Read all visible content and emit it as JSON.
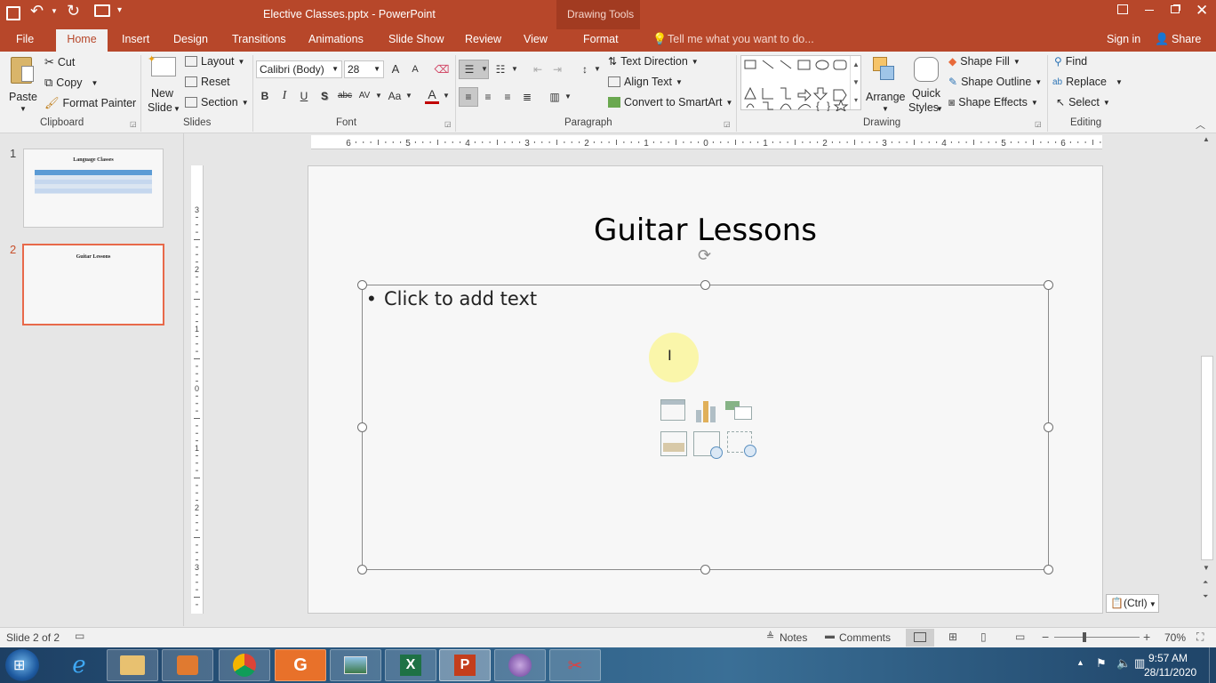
{
  "titlebar": {
    "document_title": "Elective Classes.pptx - PowerPoint",
    "context_title": "Drawing Tools"
  },
  "tabs": [
    {
      "label": "File"
    },
    {
      "label": "Home"
    },
    {
      "label": "Insert"
    },
    {
      "label": "Design"
    },
    {
      "label": "Transitions"
    },
    {
      "label": "Animations"
    },
    {
      "label": "Slide Show"
    },
    {
      "label": "Review"
    },
    {
      "label": "View"
    },
    {
      "label": "Format"
    }
  ],
  "tell_me": {
    "placeholder": "Tell me what you want to do..."
  },
  "account": {
    "sign_in": "Sign in",
    "share": "Share"
  },
  "ribbon": {
    "clipboard": {
      "label": "Clipboard",
      "paste": "Paste",
      "cut": "Cut",
      "copy": "Copy",
      "format_painter": "Format Painter"
    },
    "slides": {
      "label": "Slides",
      "new_slide_line1": "New",
      "new_slide_line2": "Slide",
      "layout": "Layout",
      "reset": "Reset",
      "section": "Section"
    },
    "font": {
      "label": "Font",
      "font_name": "Calibri (Body)",
      "font_size": "28",
      "bold": "B",
      "italic": "I",
      "underline": "U",
      "shadow": "S",
      "strike": "abc",
      "spacing": "AV",
      "case": "Aa",
      "grow": "A",
      "shrink": "A",
      "color_letter": "A",
      "font_color": "#c00000"
    },
    "paragraph": {
      "label": "Paragraph",
      "text_direction": "Text Direction",
      "align_text": "Align Text",
      "convert_smartart": "Convert to SmartArt"
    },
    "drawing": {
      "label": "Drawing",
      "arrange": "Arrange",
      "quick_styles_line1": "Quick",
      "quick_styles_line2": "Styles",
      "shape_fill": "Shape Fill",
      "shape_outline": "Shape Outline",
      "shape_effects": "Shape Effects"
    },
    "editing": {
      "label": "Editing",
      "find": "Find",
      "replace": "Replace",
      "select": "Select"
    }
  },
  "ruler": {
    "h_ticks": [
      "6",
      "5",
      "4",
      "3",
      "2",
      "1",
      "0",
      "1",
      "2",
      "3",
      "4",
      "5",
      "6"
    ],
    "v_ticks": [
      "3",
      "2",
      "1",
      "0",
      "1",
      "2",
      "3"
    ]
  },
  "thumbnails": [
    {
      "number": "1",
      "title": "Language Classes"
    },
    {
      "number": "2",
      "title": "Guitar Lessons"
    }
  ],
  "slide": {
    "title": "Guitar Lessons",
    "placeholder_bullet": "•",
    "placeholder_text": "Click to add text"
  },
  "paste_options": {
    "label": "(Ctrl)"
  },
  "status": {
    "slide_info": "Slide 2 of 2",
    "notes": "Notes",
    "comments": "Comments",
    "zoom": "70%",
    "zoom_fraction": 0.7
  },
  "taskbar": {
    "time": "9:57 AM",
    "date": "28/11/2020",
    "apps": [
      "internet-explorer",
      "file-explorer",
      "media-player",
      "chrome",
      "pdf-reader",
      "photo-viewer",
      "excel",
      "powerpoint",
      "media-app",
      "snipping-tool"
    ]
  },
  "colors": {
    "accent": "#b7472a",
    "selected_thumb_border": "#e8694a"
  }
}
